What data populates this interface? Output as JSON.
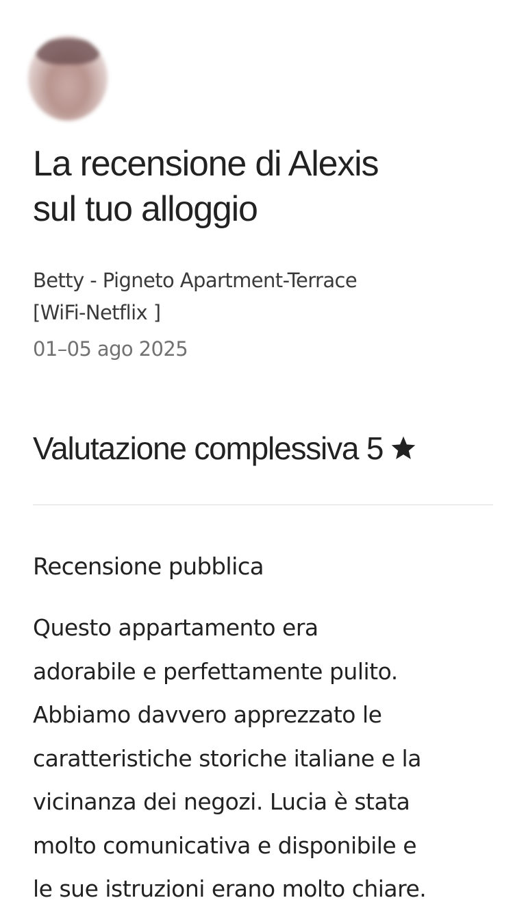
{
  "review": {
    "title_line1": "La recensione di Alexis",
    "title_line2": "sul tuo alloggio",
    "listing_line1": "Betty - Pigneto Apartment-Terrace",
    "listing_line2": "[WiFi-Netflix ]",
    "dates": "01–05 ago 2025",
    "overall_label": "Valutazione complessiva 5",
    "overall_icon": "star-icon",
    "public_review_title": "Recensione pubblica",
    "public_review_lines": [
      "Questo appartamento era",
      "adorabile e perfettamente pulito.",
      "Abbiamo davvero apprezzato le",
      "caratteristiche storiche italiane e la",
      "vicinanza dei negozi. Lucia è stata",
      "molto comunicativa e disponibile e",
      "le sue istruzioni erano molto chiare."
    ]
  },
  "colors": {
    "text_primary": "#222222",
    "text_secondary": "#717171",
    "divider": "#dddddd"
  }
}
